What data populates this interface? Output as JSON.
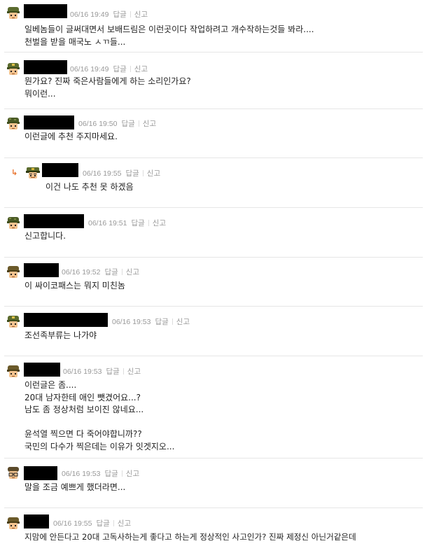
{
  "colors": {
    "accent": "#e8722c",
    "meta": "#999999",
    "text": "#222222"
  },
  "comments": [
    {
      "avatar": "soldier-avatar-icon",
      "time": "06/16 19:49",
      "reply": "답글",
      "report": "신고",
      "lines": [
        "일베놈들이 글써대면서 보배드림은 이런곳이다 작업하려고 개수작하는것들 봐라....",
        "천벌을 받을 매국노 ㅅㄲ들..."
      ]
    },
    {
      "avatar": "soldier-avatar-icon",
      "time": "06/16 19:49",
      "reply": "답글",
      "report": "신고",
      "lines": [
        "뭔가요? 진짜 죽은사람들에게 하는 소리인가요?",
        "뭐이런..."
      ]
    },
    {
      "avatar": "soldier-avatar-icon",
      "time": "06/16 19:50",
      "reply": "답글",
      "report": "신고",
      "lines": [
        "이런글에 추천 주지마세요."
      ]
    },
    {
      "avatar": "officer-avatar-icon",
      "time": "06/16 19:55",
      "reply": "답글",
      "report": "신고",
      "is_reply": true,
      "lines": [
        "이건 나도 추천 못 하겠음"
      ]
    },
    {
      "avatar": "soldier-avatar-icon",
      "time": "06/16 19:51",
      "reply": "답글",
      "report": "신고",
      "lines": [
        "신고합니다."
      ]
    },
    {
      "avatar": "soldier-avatar-icon",
      "time": "06/16 19:52",
      "reply": "답글",
      "report": "신고",
      "lines": [
        "이 싸이코패스는 뭐지 미친놈"
      ]
    },
    {
      "avatar": "soldier-avatar-icon",
      "time": "06/16 19:53",
      "reply": "답글",
      "report": "신고",
      "lines": [
        "조선족부류는 나가야"
      ]
    },
    {
      "avatar": "soldier-avatar-icon",
      "time": "06/16 19:53",
      "reply": "답글",
      "report": "신고",
      "lines": [
        "이런글은 좀....",
        "20대 남자한테 애인 뺏겼어요...?",
        "남도 좀 정상처럼 보이진 않네요...",
        "",
        "윤석열 찍으면 다 죽어야합니까??",
        "국민의 다수가 찍은데는 이유가 잇겟지오..."
      ]
    },
    {
      "avatar": "glasses-avatar-icon",
      "time": "06/16 19:53",
      "reply": "답글",
      "report": "신고",
      "lines": [
        "말을 조금 예쁘게 했더라면..."
      ]
    },
    {
      "avatar": "soldier-avatar-icon",
      "time": "06/16 19:55",
      "reply": "답글",
      "report": "신고",
      "lines": [
        "지맘에 안든다고 20대 고독사하는게 좋다고 하는게 정상적인 사고인가? 진짜 제정신 아닌거같은데"
      ]
    }
  ],
  "reply_arrow_glyph": "↳"
}
